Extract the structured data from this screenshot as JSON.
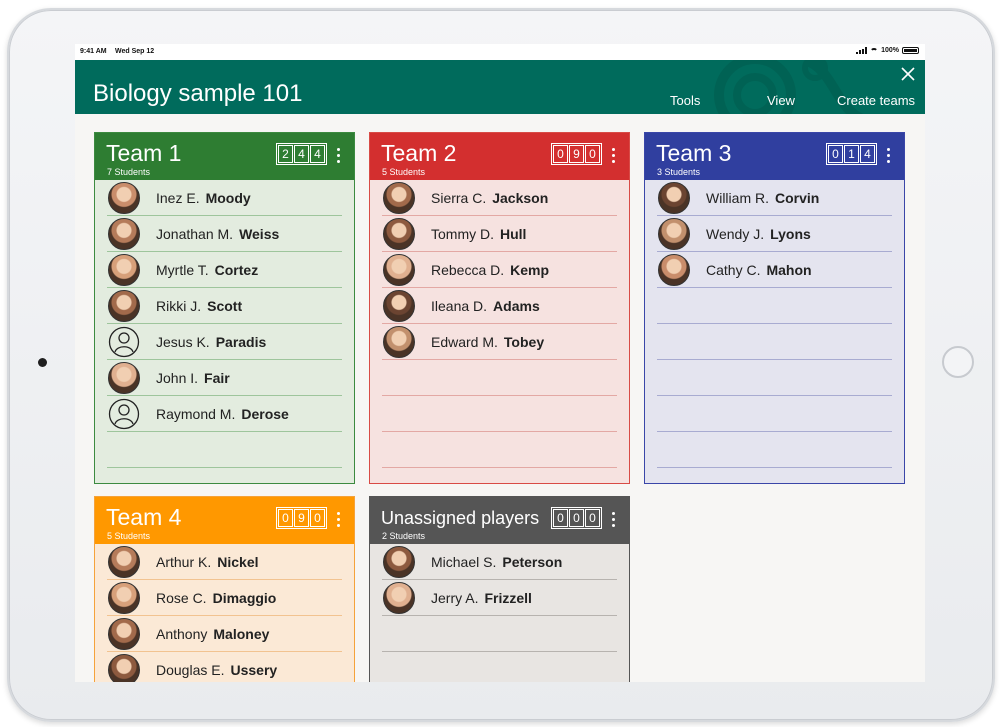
{
  "status": {
    "time": "9:41 AM",
    "date": "Wed Sep 12",
    "battery": "100%"
  },
  "header": {
    "title": "Biology sample 101",
    "tools": "Tools",
    "view": "View",
    "create": "Create teams"
  },
  "colors": {
    "header": "#006b5c",
    "team1": "#2e7d32",
    "team2": "#d32f2f",
    "team3": "#303f9f",
    "team4": "#ff9800",
    "unassigned": "#555555"
  },
  "teams": [
    {
      "title": "Team 1",
      "subtitle": "7 Students",
      "counter": [
        "2",
        "4",
        "4"
      ],
      "members": [
        {
          "first": "Inez E.",
          "last": "Moody",
          "avatar": "photo"
        },
        {
          "first": "Jonathan M.",
          "last": "Weiss",
          "avatar": "photo"
        },
        {
          "first": "Myrtle T.",
          "last": "Cortez",
          "avatar": "photo"
        },
        {
          "first": "Rikki J.",
          "last": "Scott",
          "avatar": "photo"
        },
        {
          "first": "Jesus K.",
          "last": "Paradis",
          "avatar": "placeholder"
        },
        {
          "first": "John I.",
          "last": "Fair",
          "avatar": "photo"
        },
        {
          "first": "Raymond M.",
          "last": "Derose",
          "avatar": "placeholder"
        }
      ]
    },
    {
      "title": "Team 2",
      "subtitle": "5 Students",
      "counter": [
        "0",
        "9",
        "0"
      ],
      "members": [
        {
          "first": "Sierra C.",
          "last": "Jackson",
          "avatar": "photo"
        },
        {
          "first": "Tommy D.",
          "last": "Hull",
          "avatar": "photo"
        },
        {
          "first": "Rebecca D.",
          "last": "Kemp",
          "avatar": "photo"
        },
        {
          "first": "Ileana D.",
          "last": "Adams",
          "avatar": "photo"
        },
        {
          "first": "Edward M.",
          "last": "Tobey",
          "avatar": "photo"
        }
      ]
    },
    {
      "title": "Team 3",
      "subtitle": "3 Students",
      "counter": [
        "0",
        "1",
        "4"
      ],
      "members": [
        {
          "first": "William R.",
          "last": "Corvin",
          "avatar": "photo"
        },
        {
          "first": "Wendy J.",
          "last": "Lyons",
          "avatar": "photo"
        },
        {
          "first": "Cathy  C.",
          "last": "Mahon",
          "avatar": "photo"
        }
      ]
    },
    {
      "title": "Team 4",
      "subtitle": "5 Students",
      "counter": [
        "0",
        "9",
        "0"
      ],
      "members": [
        {
          "first": "Arthur K.",
          "last": "Nickel",
          "avatar": "photo"
        },
        {
          "first": "Rose C.",
          "last": "Dimaggio",
          "avatar": "photo"
        },
        {
          "first": "Anthony",
          "last": "Maloney",
          "avatar": "photo"
        },
        {
          "first": "Douglas E.",
          "last": "Ussery",
          "avatar": "photo"
        }
      ]
    },
    {
      "title": "Unassigned players",
      "subtitle": "2 Students",
      "counter": [
        "0",
        "0",
        "0"
      ],
      "members": [
        {
          "first": "Michael S.",
          "last": "Peterson",
          "avatar": "photo"
        },
        {
          "first": "Jerry A.",
          "last": "Frizzell",
          "avatar": "photo"
        }
      ]
    }
  ]
}
